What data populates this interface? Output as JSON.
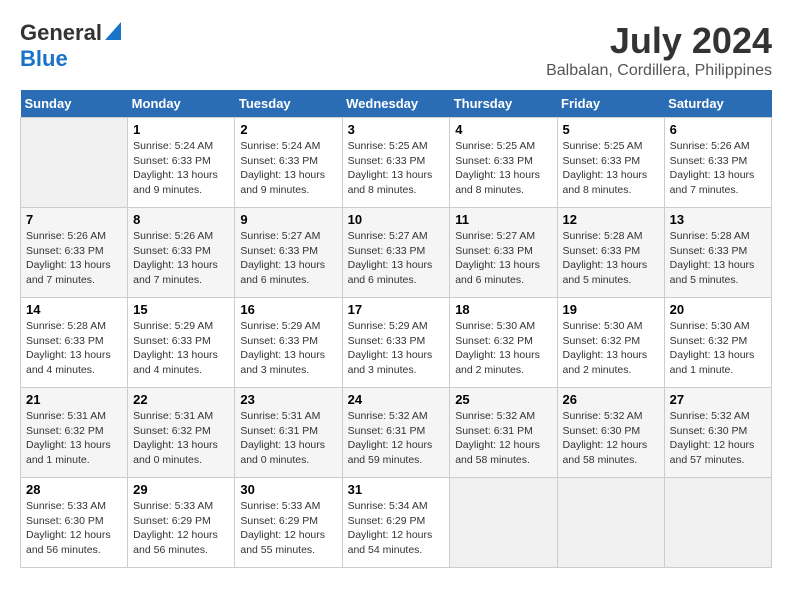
{
  "header": {
    "logo_general": "General",
    "logo_blue": "Blue",
    "month_year": "July 2024",
    "location": "Balbalan, Cordillera, Philippines"
  },
  "calendar": {
    "days_of_week": [
      "Sunday",
      "Monday",
      "Tuesday",
      "Wednesday",
      "Thursday",
      "Friday",
      "Saturday"
    ],
    "weeks": [
      [
        {
          "day": "",
          "sunrise": "",
          "sunset": "",
          "daylight": ""
        },
        {
          "day": "1",
          "sunrise": "Sunrise: 5:24 AM",
          "sunset": "Sunset: 6:33 PM",
          "daylight": "Daylight: 13 hours and 9 minutes."
        },
        {
          "day": "2",
          "sunrise": "Sunrise: 5:24 AM",
          "sunset": "Sunset: 6:33 PM",
          "daylight": "Daylight: 13 hours and 9 minutes."
        },
        {
          "day": "3",
          "sunrise": "Sunrise: 5:25 AM",
          "sunset": "Sunset: 6:33 PM",
          "daylight": "Daylight: 13 hours and 8 minutes."
        },
        {
          "day": "4",
          "sunrise": "Sunrise: 5:25 AM",
          "sunset": "Sunset: 6:33 PM",
          "daylight": "Daylight: 13 hours and 8 minutes."
        },
        {
          "day": "5",
          "sunrise": "Sunrise: 5:25 AM",
          "sunset": "Sunset: 6:33 PM",
          "daylight": "Daylight: 13 hours and 8 minutes."
        },
        {
          "day": "6",
          "sunrise": "Sunrise: 5:26 AM",
          "sunset": "Sunset: 6:33 PM",
          "daylight": "Daylight: 13 hours and 7 minutes."
        }
      ],
      [
        {
          "day": "7",
          "sunrise": "Sunrise: 5:26 AM",
          "sunset": "Sunset: 6:33 PM",
          "daylight": "Daylight: 13 hours and 7 minutes."
        },
        {
          "day": "8",
          "sunrise": "Sunrise: 5:26 AM",
          "sunset": "Sunset: 6:33 PM",
          "daylight": "Daylight: 13 hours and 7 minutes."
        },
        {
          "day": "9",
          "sunrise": "Sunrise: 5:27 AM",
          "sunset": "Sunset: 6:33 PM",
          "daylight": "Daylight: 13 hours and 6 minutes."
        },
        {
          "day": "10",
          "sunrise": "Sunrise: 5:27 AM",
          "sunset": "Sunset: 6:33 PM",
          "daylight": "Daylight: 13 hours and 6 minutes."
        },
        {
          "day": "11",
          "sunrise": "Sunrise: 5:27 AM",
          "sunset": "Sunset: 6:33 PM",
          "daylight": "Daylight: 13 hours and 6 minutes."
        },
        {
          "day": "12",
          "sunrise": "Sunrise: 5:28 AM",
          "sunset": "Sunset: 6:33 PM",
          "daylight": "Daylight: 13 hours and 5 minutes."
        },
        {
          "day": "13",
          "sunrise": "Sunrise: 5:28 AM",
          "sunset": "Sunset: 6:33 PM",
          "daylight": "Daylight: 13 hours and 5 minutes."
        }
      ],
      [
        {
          "day": "14",
          "sunrise": "Sunrise: 5:28 AM",
          "sunset": "Sunset: 6:33 PM",
          "daylight": "Daylight: 13 hours and 4 minutes."
        },
        {
          "day": "15",
          "sunrise": "Sunrise: 5:29 AM",
          "sunset": "Sunset: 6:33 PM",
          "daylight": "Daylight: 13 hours and 4 minutes."
        },
        {
          "day": "16",
          "sunrise": "Sunrise: 5:29 AM",
          "sunset": "Sunset: 6:33 PM",
          "daylight": "Daylight: 13 hours and 3 minutes."
        },
        {
          "day": "17",
          "sunrise": "Sunrise: 5:29 AM",
          "sunset": "Sunset: 6:33 PM",
          "daylight": "Daylight: 13 hours and 3 minutes."
        },
        {
          "day": "18",
          "sunrise": "Sunrise: 5:30 AM",
          "sunset": "Sunset: 6:32 PM",
          "daylight": "Daylight: 13 hours and 2 minutes."
        },
        {
          "day": "19",
          "sunrise": "Sunrise: 5:30 AM",
          "sunset": "Sunset: 6:32 PM",
          "daylight": "Daylight: 13 hours and 2 minutes."
        },
        {
          "day": "20",
          "sunrise": "Sunrise: 5:30 AM",
          "sunset": "Sunset: 6:32 PM",
          "daylight": "Daylight: 13 hours and 1 minute."
        }
      ],
      [
        {
          "day": "21",
          "sunrise": "Sunrise: 5:31 AM",
          "sunset": "Sunset: 6:32 PM",
          "daylight": "Daylight: 13 hours and 1 minute."
        },
        {
          "day": "22",
          "sunrise": "Sunrise: 5:31 AM",
          "sunset": "Sunset: 6:32 PM",
          "daylight": "Daylight: 13 hours and 0 minutes."
        },
        {
          "day": "23",
          "sunrise": "Sunrise: 5:31 AM",
          "sunset": "Sunset: 6:31 PM",
          "daylight": "Daylight: 13 hours and 0 minutes."
        },
        {
          "day": "24",
          "sunrise": "Sunrise: 5:32 AM",
          "sunset": "Sunset: 6:31 PM",
          "daylight": "Daylight: 12 hours and 59 minutes."
        },
        {
          "day": "25",
          "sunrise": "Sunrise: 5:32 AM",
          "sunset": "Sunset: 6:31 PM",
          "daylight": "Daylight: 12 hours and 58 minutes."
        },
        {
          "day": "26",
          "sunrise": "Sunrise: 5:32 AM",
          "sunset": "Sunset: 6:30 PM",
          "daylight": "Daylight: 12 hours and 58 minutes."
        },
        {
          "day": "27",
          "sunrise": "Sunrise: 5:32 AM",
          "sunset": "Sunset: 6:30 PM",
          "daylight": "Daylight: 12 hours and 57 minutes."
        }
      ],
      [
        {
          "day": "28",
          "sunrise": "Sunrise: 5:33 AM",
          "sunset": "Sunset: 6:30 PM",
          "daylight": "Daylight: 12 hours and 56 minutes."
        },
        {
          "day": "29",
          "sunrise": "Sunrise: 5:33 AM",
          "sunset": "Sunset: 6:29 PM",
          "daylight": "Daylight: 12 hours and 56 minutes."
        },
        {
          "day": "30",
          "sunrise": "Sunrise: 5:33 AM",
          "sunset": "Sunset: 6:29 PM",
          "daylight": "Daylight: 12 hours and 55 minutes."
        },
        {
          "day": "31",
          "sunrise": "Sunrise: 5:34 AM",
          "sunset": "Sunset: 6:29 PM",
          "daylight": "Daylight: 12 hours and 54 minutes."
        },
        {
          "day": "",
          "sunrise": "",
          "sunset": "",
          "daylight": ""
        },
        {
          "day": "",
          "sunrise": "",
          "sunset": "",
          "daylight": ""
        },
        {
          "day": "",
          "sunrise": "",
          "sunset": "",
          "daylight": ""
        }
      ]
    ]
  }
}
